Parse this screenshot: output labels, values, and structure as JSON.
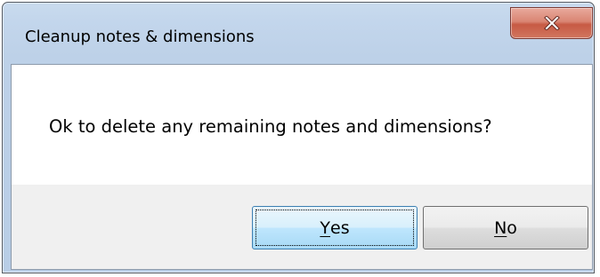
{
  "dialog": {
    "title": "Cleanup notes & dimensions",
    "message": "Ok to delete any remaining notes and dimensions?",
    "buttons": {
      "yes": {
        "mnemonic": "Y",
        "rest": "es"
      },
      "no": {
        "mnemonic": "N",
        "rest": "o"
      }
    },
    "colors": {
      "frame": "#c3d6ec",
      "close_button": "#c75a44",
      "button_bar": "#f0f0f0",
      "focused_button_border": "#3c7fb1"
    },
    "icons": {
      "close": "close-icon"
    }
  }
}
